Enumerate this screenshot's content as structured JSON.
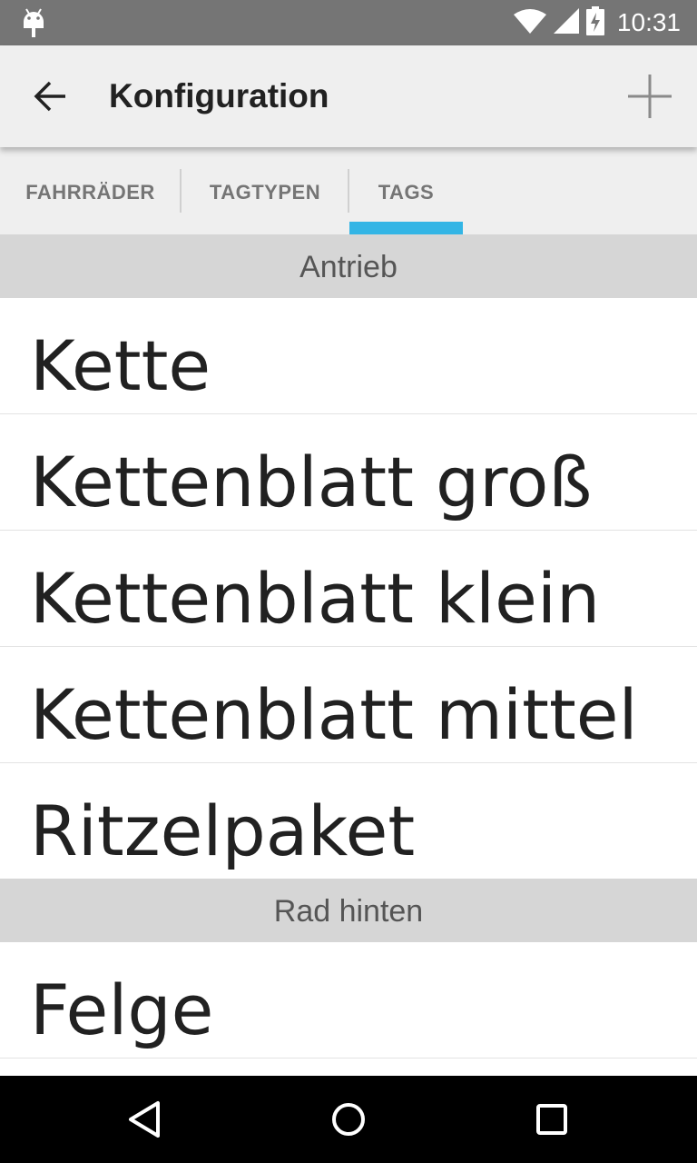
{
  "status_bar": {
    "time": "10:31",
    "left_icon": "android-debug-icon",
    "right_icons": [
      "wifi-icon",
      "cell-signal-icon",
      "battery-charging-icon"
    ]
  },
  "app_bar": {
    "title": "Konfiguration",
    "back_icon": "arrow-back-icon",
    "add_icon": "plus-icon"
  },
  "tabs": [
    {
      "label": "FAHRRÄDER",
      "selected": false
    },
    {
      "label": "TAGTYPEN",
      "selected": false
    },
    {
      "label": "TAGS",
      "selected": true
    }
  ],
  "colors": {
    "tab_indicator": "#33b5e5",
    "status_bar": "#757575",
    "app_bar": "#efefef",
    "section_header": "#d6d6d6"
  },
  "sections": [
    {
      "header": "Antrieb",
      "items": [
        "Kette",
        "Kettenblatt groß",
        "Kettenblatt klein",
        "Kettenblatt mittel",
        "Ritzelpaket"
      ]
    },
    {
      "header": "Rad hinten",
      "items": [
        "Felge"
      ]
    }
  ],
  "nav_bar": {
    "icons": [
      "nav-back-icon",
      "nav-home-icon",
      "nav-recents-icon"
    ]
  }
}
